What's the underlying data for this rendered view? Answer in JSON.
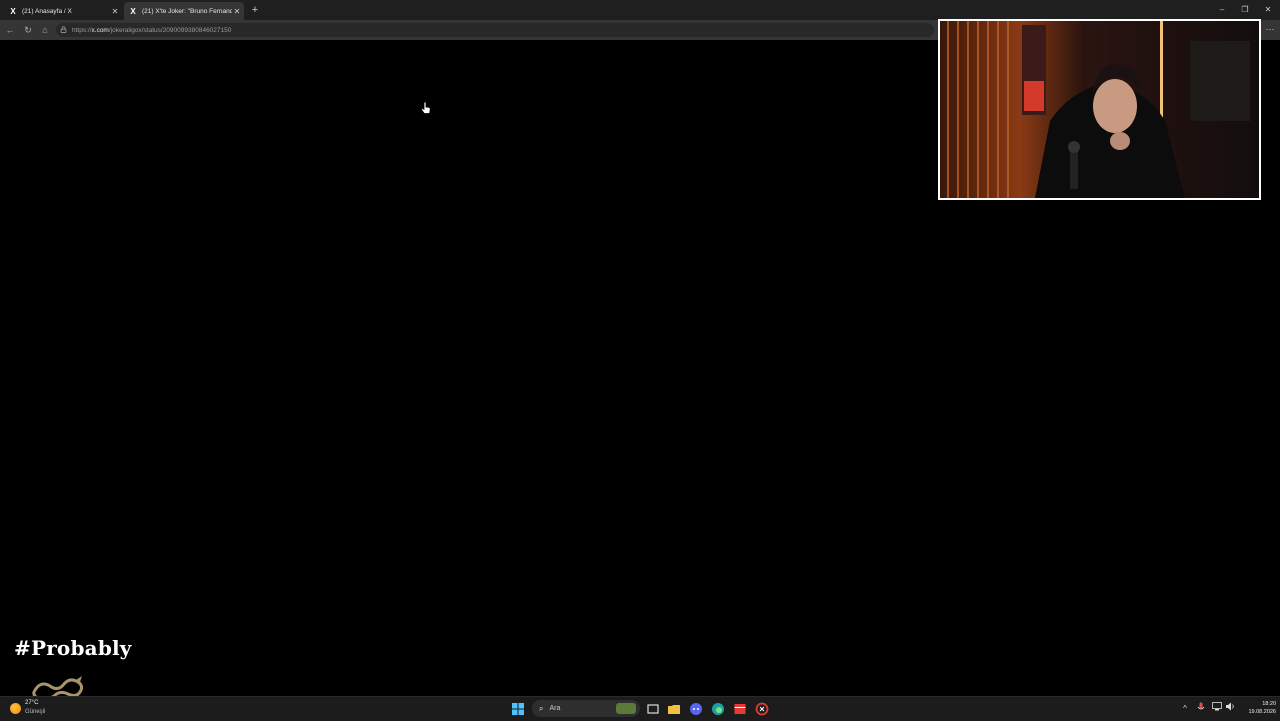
{
  "browser": {
    "tabs": [
      {
        "label": "(21) Anasayfa / X",
        "logo": "X"
      },
      {
        "label": "(21) X'te Joker: \"Bruno Fernandes",
        "logo": "X"
      }
    ],
    "new_tab": "+",
    "url_prefix": "https://",
    "url_host": "x.com",
    "url_path": "/jokeraligox/status/2090099380846027150"
  },
  "overlay": {
    "probably_text": "#Probably"
  },
  "taskbar": {
    "weather_temp": "27°C",
    "weather_condition": "Güneşli",
    "search_label": "Ara",
    "clock_time": "18:20",
    "clock_date": "19.08.2026"
  },
  "colors": {
    "background": "#000000",
    "tabbar": "#1f1f1f",
    "toolbar": "#353535",
    "taskbar": "#1c1c1c",
    "webcam_border": "#ffffff"
  }
}
